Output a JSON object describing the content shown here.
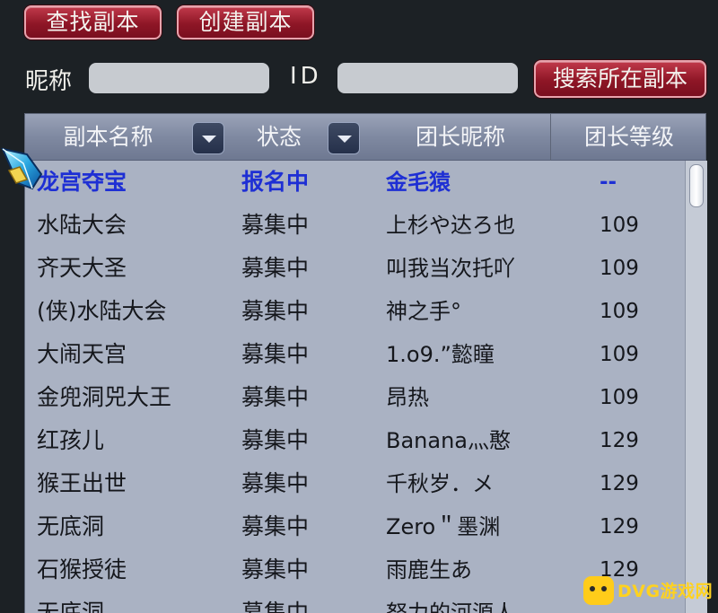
{
  "tabs": {
    "find_label": "查找副本",
    "create_label": "创建副本"
  },
  "search": {
    "nickname_label": "昵称",
    "nickname_value": "",
    "id_label": "ID",
    "id_value": "",
    "search_button": "搜索所在副本"
  },
  "table": {
    "headers": {
      "name": "副本名称",
      "status": "状态",
      "leader": "团长昵称",
      "level": "团长等级"
    },
    "rows": [
      {
        "name": "龙宫夺宝",
        "status": "报名中",
        "leader": "金毛猿",
        "level": "--",
        "selected": true
      },
      {
        "name": "水陆大会",
        "status": "募集中",
        "leader": "上杉や达ろ也",
        "level": "109"
      },
      {
        "name": "齐天大圣",
        "status": "募集中",
        "leader": "叫我当次托吖",
        "level": "109"
      },
      {
        "name": "(侠)水陆大会",
        "status": "募集中",
        "leader": "神之手°",
        "level": "109"
      },
      {
        "name": "大闹天宫",
        "status": "募集中",
        "leader": "1.o9.”懿瞳",
        "level": "109"
      },
      {
        "name": "金兜洞兕大王",
        "status": "募集中",
        "leader": "昂热",
        "level": "109"
      },
      {
        "name": "红孩儿",
        "status": "募集中",
        "leader": "Banana灬憨",
        "level": "129"
      },
      {
        "name": "猴王出世",
        "status": "募集中",
        "leader": "千秋岁．メ",
        "level": "129"
      },
      {
        "name": "无底洞",
        "status": "募集中",
        "leader": "Zero＂墨渊",
        "level": "129"
      },
      {
        "name": "石猴授徒",
        "status": "募集中",
        "leader": "雨鹿生あ",
        "level": "129"
      },
      {
        "name": "无底洞",
        "status": "募集中",
        "leader": "努力的河源人",
        "level": ""
      }
    ]
  },
  "watermark": {
    "text": "DVG游戏网"
  },
  "colors": {
    "button_red": "#8e1626",
    "selected_row_text": "#1e2fd4",
    "table_bg": "#aab2c3",
    "header_bg": "#7f89a1"
  },
  "icons": {
    "cursor": "gem-cursor-icon",
    "dropdown": "chevron-down-icon",
    "watermark_logo": "controller-icon"
  }
}
